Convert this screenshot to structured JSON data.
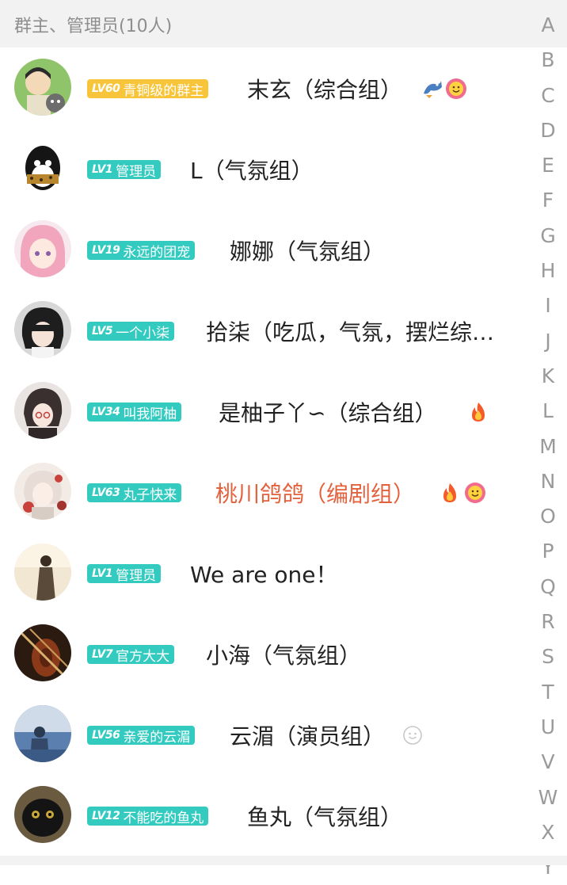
{
  "header": {
    "title": "群主、管理员(10人)"
  },
  "members": [
    {
      "lv": "LV60",
      "title": "青铜级的群主",
      "name": "末玄（综合组）",
      "badge_color": "#f7c43a",
      "name_color": "#222222",
      "emojis": [
        "dragon-emoji",
        "smile-flower-emoji"
      ]
    },
    {
      "lv": "LV1",
      "title": "管理员",
      "name": "L（气氛组）",
      "badge_color": "#33cbc0",
      "name_color": "#222222",
      "emojis": []
    },
    {
      "lv": "LV19",
      "title": "永远的团宠",
      "name": "娜娜（气氛组）",
      "badge_color": "#33cbc0",
      "name_color": "#222222",
      "emojis": []
    },
    {
      "lv": "LV5",
      "title": "一个小柒",
      "name": "拾柒（吃瓜，气氛，摆烂综…",
      "badge_color": "#33cbc0",
      "name_color": "#222222",
      "emojis": []
    },
    {
      "lv": "LV34",
      "title": "叫我阿柚",
      "name": "是柚子丫∽（综合组）",
      "badge_color": "#33cbc0",
      "name_color": "#222222",
      "emojis": [
        "fire-emoji"
      ]
    },
    {
      "lv": "LV63",
      "title": "丸子快来",
      "name": "桃川鸽鸽（编剧组）",
      "badge_color": "#33cbc0",
      "name_color": "#e3623d",
      "emojis": [
        "fire-emoji",
        "smile-flower-emoji"
      ]
    },
    {
      "lv": "LV1",
      "title": "管理员",
      "name": "We are one！",
      "badge_color": "#33cbc0",
      "name_color": "#222222",
      "emojis": []
    },
    {
      "lv": "LV7",
      "title": "官方大大",
      "name": "小海（气氛组）",
      "badge_color": "#33cbc0",
      "name_color": "#222222",
      "emojis": []
    },
    {
      "lv": "LV56",
      "title": "亲爱的云湄",
      "name": "云湄（演员组）",
      "badge_color": "#33cbc0",
      "name_color": "#222222",
      "emojis": [
        "outline-smile-emoji"
      ]
    },
    {
      "lv": "LV12",
      "title": "不能吃的鱼丸",
      "name": "鱼丸（气氛组）",
      "badge_color": "#33cbc0",
      "name_color": "#222222",
      "emojis": []
    }
  ],
  "index_letters": [
    "A",
    "B",
    "C",
    "D",
    "E",
    "F",
    "G",
    "H",
    "I",
    "J",
    "K",
    "L",
    "M",
    "N",
    "O",
    "P",
    "Q",
    "R",
    "S",
    "T",
    "U",
    "V",
    "W",
    "X",
    "Y"
  ]
}
